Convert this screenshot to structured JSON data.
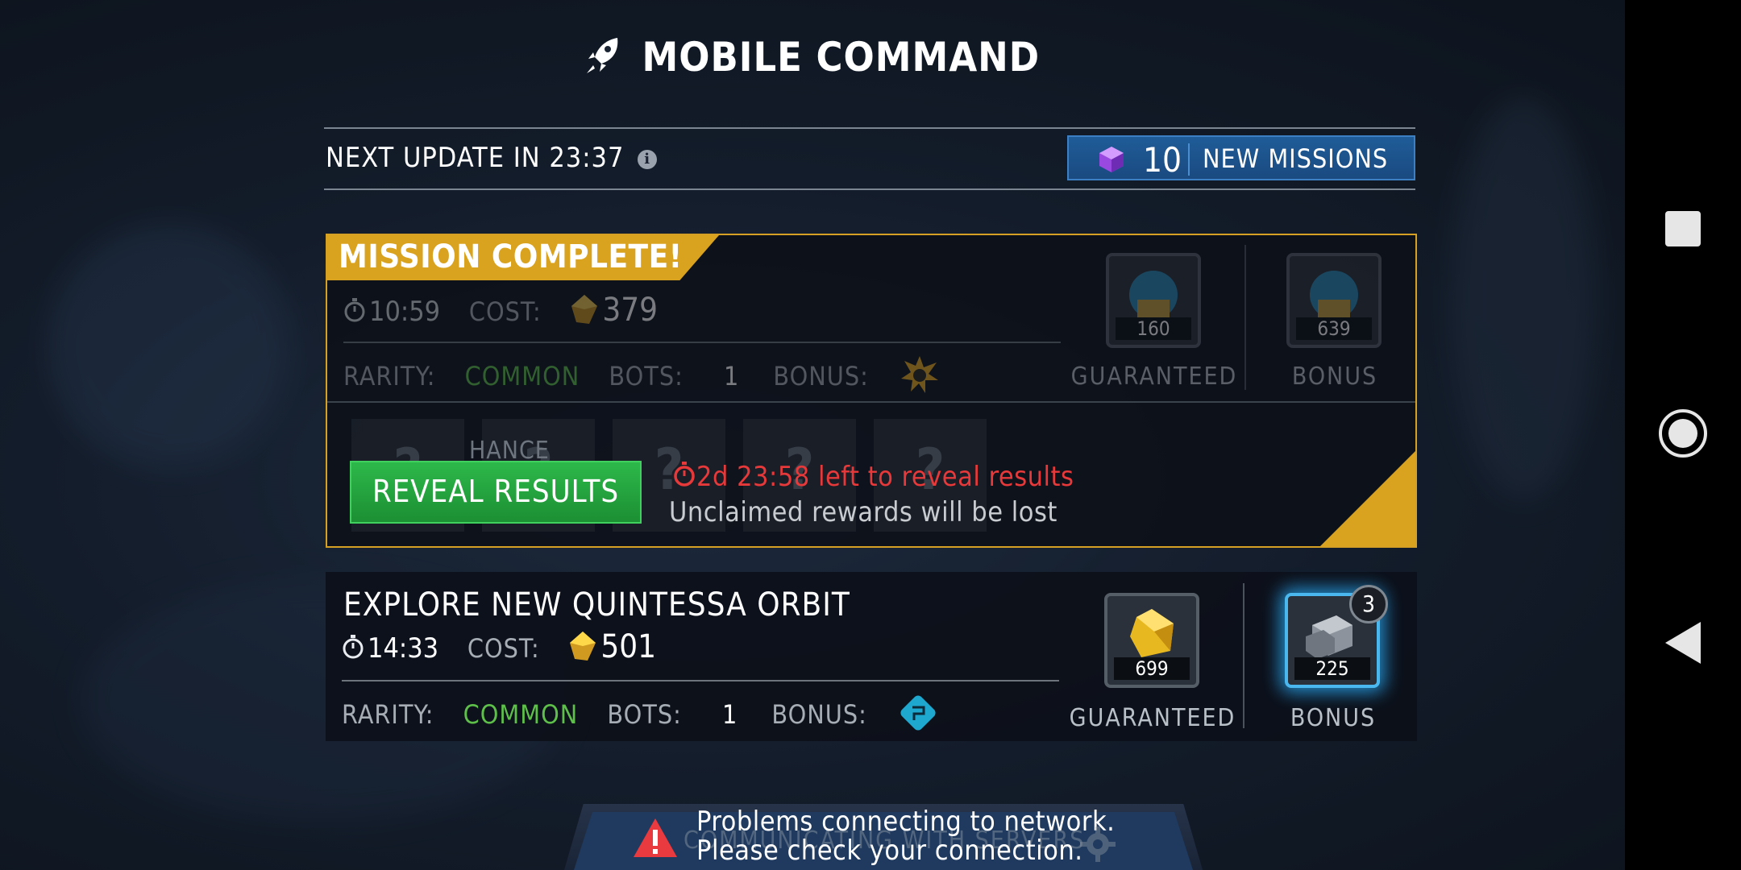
{
  "header": {
    "title": "MOBILE COMMAND"
  },
  "update_bar": {
    "next_update_label": "NEXT UPDATE IN 23:37",
    "new_missions_count": "10",
    "new_missions_label": "NEW MISSIONS"
  },
  "completed_mission": {
    "banner": "MISSION COMPLETE!",
    "time": "10:59",
    "cost_label": "COST:",
    "cost_value": "379",
    "rarity_label": "RARITY:",
    "rarity_value": "COMMON",
    "bots_label": "BOTS:",
    "bots_value": "1",
    "bonus_label": "BONUS:",
    "guaranteed_count": "160",
    "guaranteed_label": "GUARANTEED",
    "bonus_count": "639",
    "bonus_reward_label": "BONUS",
    "chance_label": "HANCE",
    "reveal_button": "REVEAL RESULTS",
    "reveal_timer": "2d 23:58 left to reveal results",
    "reveal_note": "Unclaimed rewards will be lost"
  },
  "mission": {
    "title": "EXPLORE NEW QUINTESSA ORBIT",
    "time": "14:33",
    "cost_label": "COST:",
    "cost_value": "501",
    "rarity_label": "RARITY:",
    "rarity_value": "COMMON",
    "bots_label": "BOTS:",
    "bots_value": "1",
    "bonus_label": "BONUS:",
    "guaranteed_count": "699",
    "guaranteed_label": "GUARANTEED",
    "bonus_count": "225",
    "bonus_reward_label": "BONUS",
    "bonus_badge": "3"
  },
  "network_error": {
    "underlay": "COMMUNICATING WITH SERVERS",
    "line1": "Problems connecting to network.",
    "line2": "Please check your connection."
  },
  "colors": {
    "gold": "#d9a21f",
    "green": "#2db84a",
    "blue": "#1f5c98",
    "red": "#e8393a"
  }
}
